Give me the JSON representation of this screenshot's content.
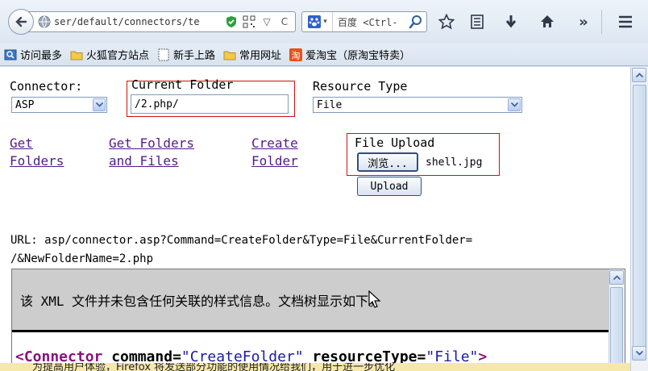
{
  "toolbar": {
    "url": "ser/default/connectors/te",
    "search_engine": "百度",
    "search_placeholder": "<Ctrl-"
  },
  "bookmarks": [
    {
      "label": "访问最多",
      "icon": "most-visited-icon"
    },
    {
      "label": "火狐官方站点",
      "icon": "folder-icon"
    },
    {
      "label": "新手上路",
      "icon": "blank-page-icon"
    },
    {
      "label": "常用网址",
      "icon": "folder-icon"
    },
    {
      "label": "爱淘宝（原淘宝特卖）",
      "icon": "taobao-icon"
    }
  ],
  "form": {
    "connector_label": "Connector:",
    "connector_value": "ASP",
    "folder_label": "Current Folder",
    "folder_value": "/2.php/",
    "resource_label": "Resource Type",
    "resource_value": "File",
    "link_get_folders_1": "Get",
    "link_get_folders_2": "Folders",
    "link_get_files_1": "Get Folders",
    "link_get_files_2": "and Files",
    "link_create_1": "Create",
    "link_create_2": "Folder",
    "upload_label": "File Upload",
    "browse_button": "浏览...",
    "file_name": "shell.jpg",
    "upload_button": "Upload"
  },
  "result": {
    "url_line1": "URL: asp/connector.asp?Command=CreateFolder&Type=File&CurrentFolder=",
    "url_line2": "/&NewFolderName=2.php",
    "xml_notice": "该 XML 文件并未包含任何关联的样式信息。文档树显示如下。",
    "xml_tag": "<Connector",
    "xml_attr1": " command=",
    "xml_val1": "\"CreateFolder\"",
    "xml_attr2": " resourceType=",
    "xml_val2": "\"File\"",
    "xml_end": ">"
  },
  "notification": "为提高用户体验，Firefox 将发送部分功能的使用情况给我们，用于进一步优化"
}
